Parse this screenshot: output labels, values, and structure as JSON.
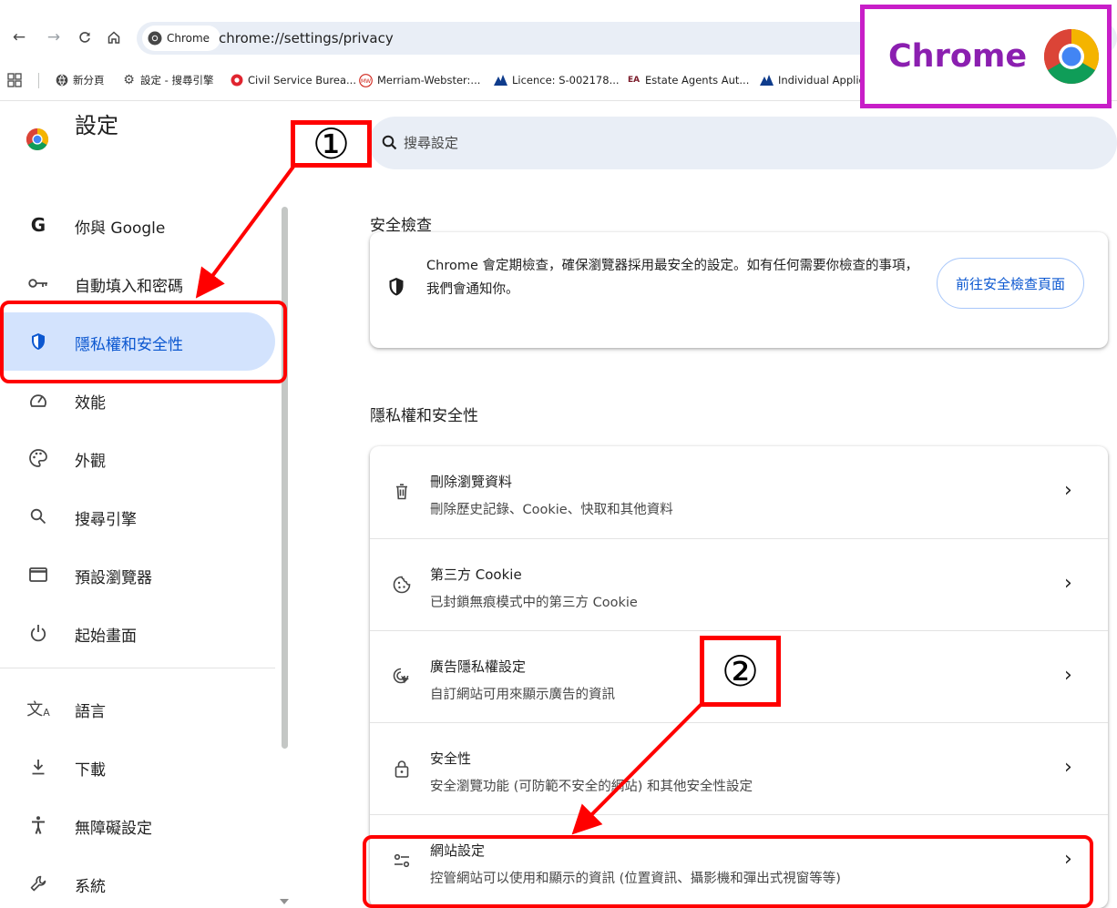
{
  "browser": {
    "origin_chip": "Chrome",
    "url": "chrome://settings/privacy",
    "bookmarks": [
      {
        "label": "新分頁",
        "icon": "globe-icon"
      },
      {
        "label": "設定 - 搜尋引擎",
        "icon": "gear-icon"
      },
      {
        "label": "Civil Service Burea...",
        "icon": "gov-logo-icon"
      },
      {
        "label": "Merriam-Webster:...",
        "icon": "mw-icon"
      },
      {
        "label": "Licence: S-002178...",
        "icon": "mountain-icon"
      },
      {
        "label": "Estate Agents Aut...",
        "icon": "eaa-icon"
      },
      {
        "label": "Individual Applica...",
        "icon": "mountain-icon"
      }
    ]
  },
  "settings": {
    "title": "設定",
    "search_placeholder": "搜尋設定"
  },
  "sidebar": {
    "items": [
      {
        "label": "你與 Google",
        "icon": "google-g-icon"
      },
      {
        "label": "自動填入和密碼",
        "icon": "key-icon"
      },
      {
        "label": "隱私權和安全性",
        "icon": "shield-icon",
        "active": true
      },
      {
        "label": "效能",
        "icon": "speedometer-icon"
      },
      {
        "label": "外觀",
        "icon": "palette-icon"
      },
      {
        "label": "搜尋引擎",
        "icon": "search-icon"
      },
      {
        "label": "預設瀏覽器",
        "icon": "browser-window-icon"
      },
      {
        "label": "起始畫面",
        "icon": "power-icon"
      },
      {
        "label": "語言",
        "icon": "translate-icon"
      },
      {
        "label": "下載",
        "icon": "download-icon"
      },
      {
        "label": "無障礙設定",
        "icon": "accessibility-icon"
      },
      {
        "label": "系統",
        "icon": "wrench-icon"
      }
    ]
  },
  "main": {
    "safety": {
      "title": "安全檢查",
      "text": "Chrome 會定期檢查，確保瀏覽器採用最安全的設定。如有任何需要你檢查的事項，我們會通知你。",
      "button": "前往安全檢查頁面"
    },
    "privacy": {
      "title": "隱私權和安全性",
      "rows": [
        {
          "title": "刪除瀏覽資料",
          "sub": "刪除歷史記錄、Cookie、快取和其他資料",
          "icon": "trash-icon"
        },
        {
          "title": "第三方 Cookie",
          "sub": "已封鎖無痕模式中的第三方 Cookie",
          "icon": "cookie-icon"
        },
        {
          "title": "廣告隱私權設定",
          "sub": "自訂網站可用來顯示廣告的資訊",
          "icon": "ads-privacy-icon"
        },
        {
          "title": "安全性",
          "sub": "安全瀏覽功能 (可防範不安全的網站) 和其他安全性設定",
          "icon": "lock-icon"
        },
        {
          "title": "網站設定",
          "sub": "控管網站可以使用和顯示的資訊 (位置資訊、攝影機和彈出式視窗等等)",
          "icon": "tune-icon"
        }
      ]
    }
  },
  "annotations": {
    "step1": "①",
    "step2": "②",
    "badge": "Chrome",
    "color": "#ff0000",
    "badge_color": "#c81ec8"
  }
}
